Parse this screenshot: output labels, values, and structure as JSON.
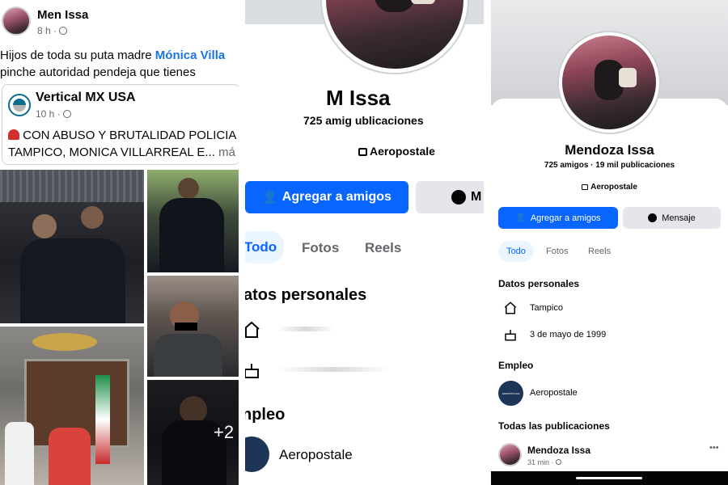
{
  "post": {
    "author_name": "Men      Issa",
    "time": "8 h ·",
    "text_prefix": "Hijos de toda su puta madre ",
    "mention": "Mónica Villa",
    "text_line2": "pinche autoridad pendeja que tienes",
    "shared_page_name": "Vertical MX USA",
    "shared_time": "10 h ·",
    "shared_snippet_line1": "CON ABUSO Y BRUTALIDAD POLICIA",
    "shared_snippet_line2": "TAMPICO, MONICA VILLARREAL E...",
    "shared_more": " má",
    "photo_more_count": "+2"
  },
  "profile_zoom": {
    "name": "M       Issa",
    "stats": "725 amig         ublicaciones",
    "work": "Aeropostale",
    "add_friend_label": "Agregar a amigos",
    "message_label_partial": "M",
    "tabs": [
      "Todo",
      "Fotos",
      "Reels"
    ],
    "personal_section": "atos personales",
    "employment_section": "npleo",
    "employer": "Aeropostale"
  },
  "profile": {
    "name": "Mendoza Issa",
    "stats": "725 amigos · 19 mil publicaciones",
    "work": "Aeropostale",
    "add_friend_label": "Agregar a amigos",
    "message_label": "Mensaje",
    "tabs": [
      "Todo",
      "Fotos",
      "Reels"
    ],
    "personal_section": "Datos personales",
    "city": "Tampico",
    "birthday": "3 de mayo de 1999",
    "employment_section": "Empleo",
    "employer": "Aeropostale",
    "employer_logo_text": "AEROPOSTALE",
    "all_posts_section": "Todas las publicaciones",
    "post_author": "Mendoza Issa",
    "post_time": "31 min ·",
    "more_options": "•••"
  },
  "colors": {
    "facebook_blue": "#0866ff",
    "secondary_button": "#e4e6eb",
    "muted_text": "#65676b",
    "active_tab_bg": "#ebf5ff"
  }
}
